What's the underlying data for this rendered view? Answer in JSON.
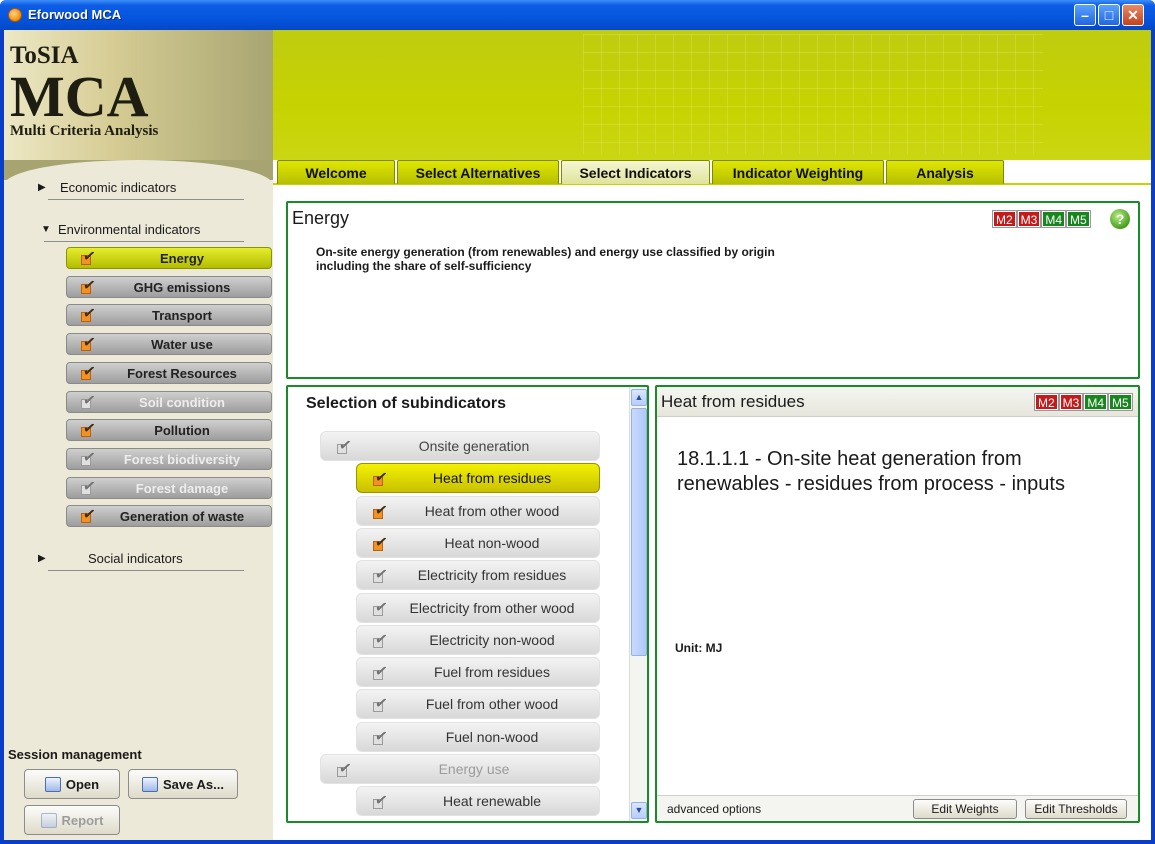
{
  "window": {
    "title": "Eforwood MCA"
  },
  "logo": {
    "line1": "ToSIA",
    "line2": "MCA",
    "line3": "Multi Criteria Analysis"
  },
  "nav": {
    "economic": "Economic indicators",
    "environmental": "Environmental indicators",
    "social": "Social indicators",
    "items": [
      {
        "label": "Energy",
        "state": "active"
      },
      {
        "label": "GHG emissions",
        "state": "normal"
      },
      {
        "label": "Transport",
        "state": "normal"
      },
      {
        "label": "Water use",
        "state": "normal"
      },
      {
        "label": "Forest Resources",
        "state": "normal"
      },
      {
        "label": "Soil condition",
        "state": "disabled"
      },
      {
        "label": "Pollution",
        "state": "normal"
      },
      {
        "label": "Forest biodiversity",
        "state": "disabled"
      },
      {
        "label": "Forest damage",
        "state": "disabled"
      },
      {
        "label": "Generation of waste",
        "state": "normal"
      }
    ]
  },
  "session": {
    "title": "Session management",
    "open": "Open",
    "save_as": "Save As...",
    "report": "Report"
  },
  "tabs": [
    {
      "label": "Welcome"
    },
    {
      "label": "Select Alternatives"
    },
    {
      "label": "Select Indicators",
      "active": true
    },
    {
      "label": "Indicator Weighting"
    },
    {
      "label": "Analysis"
    }
  ],
  "energy_panel": {
    "title": "Energy",
    "badges": [
      "M2",
      "M3",
      "M4",
      "M5"
    ],
    "help": "?",
    "description": "On-site energy generation (from renewables) and energy use classified by origin including the share of self-sufficiency"
  },
  "subindicators": {
    "title": "Selection of subindicators",
    "items": [
      {
        "label": "Onsite generation",
        "type": "group"
      },
      {
        "label": "Heat from residues",
        "type": "item",
        "checked": true,
        "active": true
      },
      {
        "label": "Heat from other wood",
        "type": "item",
        "checked": true
      },
      {
        "label": "Heat non-wood",
        "type": "item",
        "checked": true
      },
      {
        "label": "Electricity from residues",
        "type": "item",
        "checked": false
      },
      {
        "label": "Electricity from other wood",
        "type": "item",
        "checked": false
      },
      {
        "label": "Electricity non-wood",
        "type": "item",
        "checked": false
      },
      {
        "label": "Fuel from residues",
        "type": "item",
        "checked": false
      },
      {
        "label": "Fuel from other wood",
        "type": "item",
        "checked": false
      },
      {
        "label": "Fuel non-wood",
        "type": "item",
        "checked": false
      },
      {
        "label": "Energy use",
        "type": "group-muted"
      },
      {
        "label": "Heat renewable",
        "type": "item",
        "checked": false
      }
    ]
  },
  "detail": {
    "title": "Heat from residues",
    "badges": [
      "M2",
      "M3",
      "M4",
      "M5"
    ],
    "text": "18.1.1.1 - On-site heat generation from renewables - residues from process - inputs",
    "unit": "Unit: MJ",
    "advanced": "advanced options",
    "edit_weights": "Edit Weights",
    "edit_thresholds": "Edit Thresholds"
  },
  "colors": {
    "accent": "#c7d300",
    "panel_border": "#1b8a29",
    "badge_red": "#c41a1a",
    "badge_green": "#17871d"
  }
}
